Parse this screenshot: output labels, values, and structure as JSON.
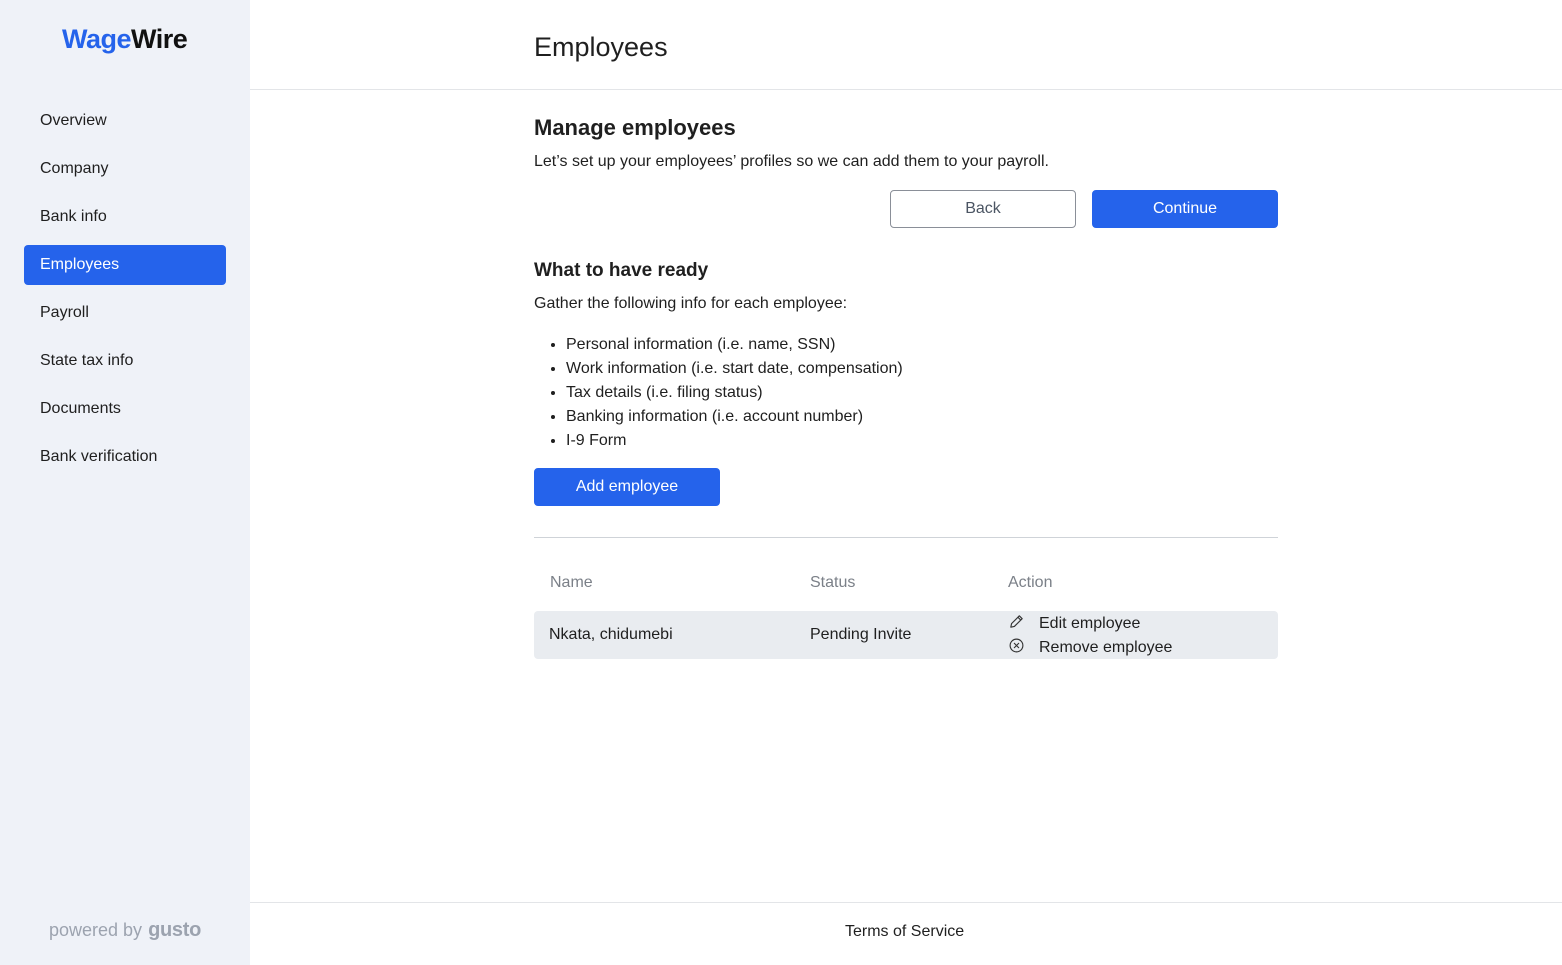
{
  "brand": {
    "logo_part1": "Wage",
    "logo_part2": "Wire",
    "powered_by": "powered by",
    "powered_brand": "gusto"
  },
  "sidebar": {
    "items": [
      {
        "label": "Overview"
      },
      {
        "label": "Company"
      },
      {
        "label": "Bank info"
      },
      {
        "label": "Employees",
        "active": true
      },
      {
        "label": "Payroll"
      },
      {
        "label": "State tax info"
      },
      {
        "label": "Documents"
      },
      {
        "label": "Bank verification"
      }
    ]
  },
  "header": {
    "title": "Employees"
  },
  "manage": {
    "heading": "Manage employees",
    "description": "Let’s set up your employees’ profiles so we can add them to your payroll.",
    "back_label": "Back",
    "continue_label": "Continue"
  },
  "ready": {
    "heading": "What to have ready",
    "intro": "Gather the following info for each employee:",
    "items": [
      "Personal information (i.e. name, SSN)",
      "Work information (i.e. start date, compensation)",
      "Tax details (i.e. filing status)",
      "Banking information (i.e. account number)",
      "I-9 Form"
    ],
    "add_label": "Add employee"
  },
  "table": {
    "headers": {
      "name": "Name",
      "status": "Status",
      "action": "Action"
    },
    "rows": [
      {
        "name": "Nkata, chidumebi",
        "status": "Pending Invite",
        "edit_label": "Edit employee",
        "remove_label": "Remove employee"
      }
    ]
  },
  "footer": {
    "terms": "Terms of Service"
  },
  "colors": {
    "accent": "#2563eb",
    "sidebar_bg": "#eff2f8",
    "row_bg": "#e9ecf0"
  },
  "icons": {
    "edit": "pencil-icon",
    "remove": "circle-x-icon"
  }
}
